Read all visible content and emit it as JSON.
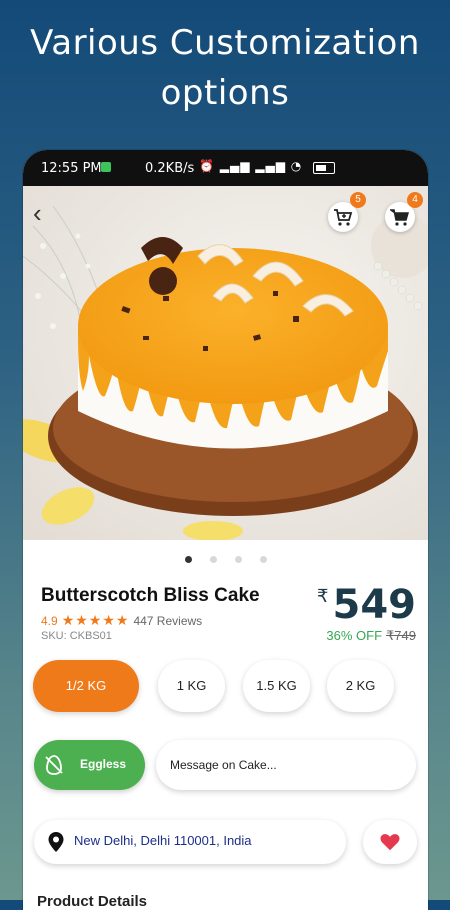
{
  "promo": {
    "line1": "Various Customization",
    "line2": "options"
  },
  "status_bar": {
    "time": "12:55 PM",
    "speed": "0.2KB/s"
  },
  "header": {
    "back_icon": "chevron-left-icon",
    "wishlist_cart_count": "5",
    "cart_count": "4"
  },
  "carousel": {
    "count": 4,
    "active": 0
  },
  "product": {
    "title": "Butterscotch Bliss Cake",
    "rating": "4.9",
    "stars": "★★★★★",
    "reviews": "447 Reviews",
    "sku": "SKU: CKBS01",
    "currency": "₹",
    "price": "549",
    "discount": "36% OFF",
    "old_price": "₹749"
  },
  "weights": [
    {
      "label": "1/2 KG",
      "selected": true
    },
    {
      "label": "1 KG",
      "selected": false
    },
    {
      "label": "1.5 KG",
      "selected": false
    },
    {
      "label": "2 KG",
      "selected": false
    }
  ],
  "options": {
    "eggless_label": "Eggless",
    "message_placeholder": "Message on Cake..."
  },
  "location": {
    "text": "New Delhi, Delhi 110001, India"
  },
  "section": {
    "title": "Product Details"
  },
  "colors": {
    "accent": "#ef7a1a",
    "green": "#4caf50",
    "heart": "#e53950"
  }
}
